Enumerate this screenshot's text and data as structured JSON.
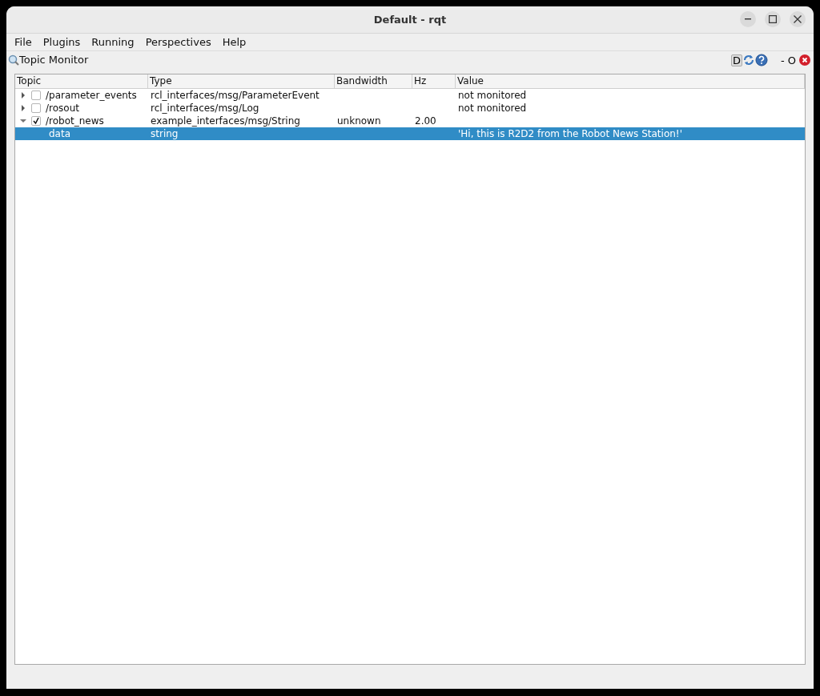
{
  "window": {
    "title": "Default - rqt"
  },
  "menu": [
    {
      "label": "File"
    },
    {
      "label": "Plugins"
    },
    {
      "label": "Running"
    },
    {
      "label": "Perspectives"
    },
    {
      "label": "Help"
    }
  ],
  "dock": {
    "title": "Topic Monitor",
    "buttons": [
      "D",
      "-",
      "O"
    ]
  },
  "table": {
    "columns": [
      "Topic",
      "Type",
      "Bandwidth",
      "Hz",
      "Value"
    ],
    "rows": [
      {
        "expanded": false,
        "checked": false,
        "selected": false,
        "cells": [
          "/parameter_events",
          "rcl_interfaces/msg/ParameterEvent",
          "",
          "",
          "not monitored"
        ],
        "children": []
      },
      {
        "expanded": false,
        "checked": false,
        "selected": false,
        "cells": [
          "/rosout",
          "rcl_interfaces/msg/Log",
          "",
          "",
          "not monitored"
        ],
        "children": []
      },
      {
        "expanded": true,
        "checked": true,
        "selected": false,
        "cells": [
          "/robot_news",
          "example_interfaces/msg/String",
          "unknown",
          "2.00",
          ""
        ],
        "children": [
          {
            "selected": true,
            "cells": [
              "data",
              "string",
              "",
              "",
              "'Hi, this is R2D2 from the Robot News Station!'"
            ]
          }
        ]
      }
    ]
  }
}
